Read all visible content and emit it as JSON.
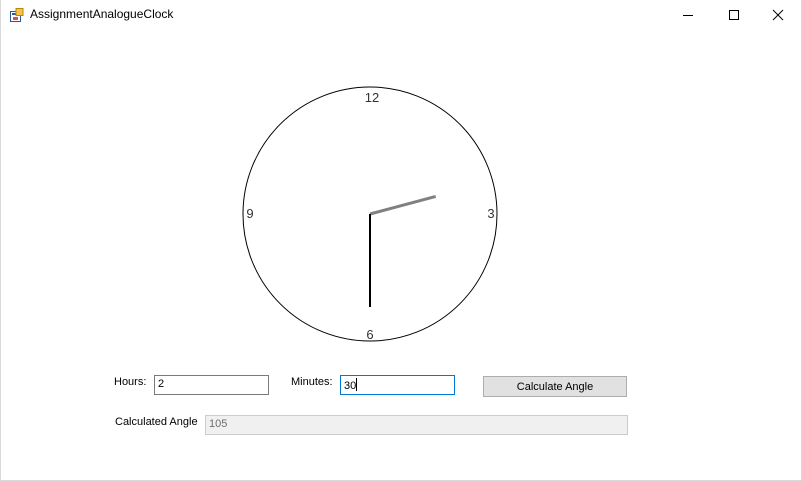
{
  "window": {
    "title": "AssignmentAnalogueClock",
    "icon": "winforms-app-icon",
    "controls": {
      "minimize_icon": "minimize-icon",
      "maximize_icon": "maximize-icon",
      "close_icon": "close-icon"
    }
  },
  "clock": {
    "numerals": {
      "twelve": "12",
      "three": "3",
      "six": "6",
      "nine": "9"
    },
    "time": {
      "hours": 2,
      "minutes": 30
    },
    "hour_hand_color": "#808080",
    "minute_hand_color": "#000000"
  },
  "form": {
    "hours_label": "Hours:",
    "hours_value": "2",
    "minutes_label": "Minutes:",
    "minutes_value": "30",
    "calculate_button_label": "Calculate Angle",
    "result_label": "Calculated Angle",
    "result_value": "105"
  },
  "colors": {
    "focus_border": "#0078d7",
    "button_face": "#e1e1e1",
    "readonly_background": "#f0f0f0"
  }
}
